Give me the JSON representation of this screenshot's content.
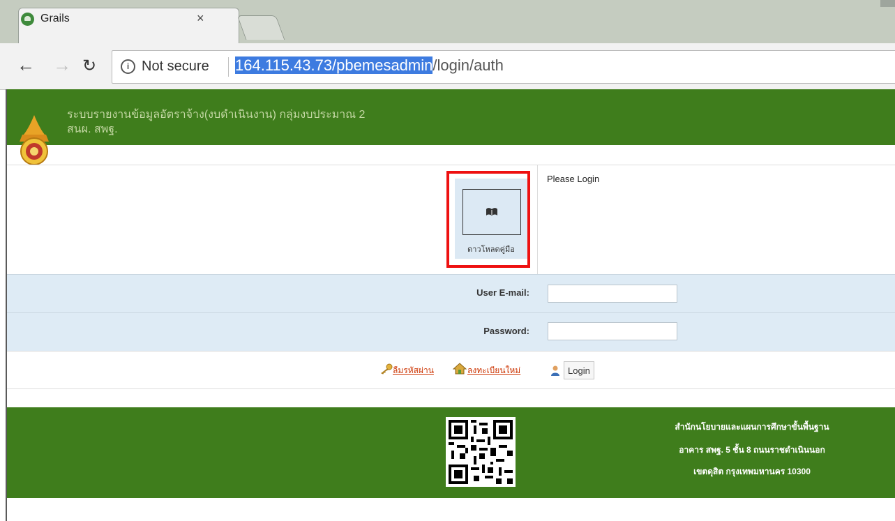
{
  "browser": {
    "tab_title": "Grails",
    "tab_close": "×",
    "security_text": "Not secure",
    "info_glyph": "i",
    "url_highlight": "164.115.43.73/pbemesadmin",
    "url_rest": "/login/auth",
    "icons": [
      "back-icon",
      "forward-icon",
      "reload-icon",
      "info-icon"
    ]
  },
  "header": {
    "line1": "ระบบรายงานข้อมูลอัตราจ้าง(งบดำเนินงาน) กลุ่มงบประมาณ 2",
    "line2": "สนผ. สพฐ.",
    "color": "#3f7d1c"
  },
  "download": {
    "label": "ดาวโหลดคู่มือ"
  },
  "login": {
    "prompt": "Please Login",
    "email_label": "User E-mail:",
    "email_value": "",
    "password_label": "Password:",
    "password_value": "",
    "forgot_label": "ลืมรหัสผ่าน",
    "register_label": "ลงทะเบียนใหม่",
    "button_label": "Login"
  },
  "footer": {
    "line1": "สำนักนโยบายและแผนการศึกษาขั้นพื้นฐาน",
    "line2": "อาคาร สพฐ. 5 ชั้น 8 ถนนราชดำเนินนอก",
    "line3": "เขตดุสิต กรุงเทพมหานคร 10300"
  },
  "colors": {
    "highlight_box": "#ee1111",
    "form_row": "#deebf5",
    "url_selection": "#3d7be0"
  }
}
